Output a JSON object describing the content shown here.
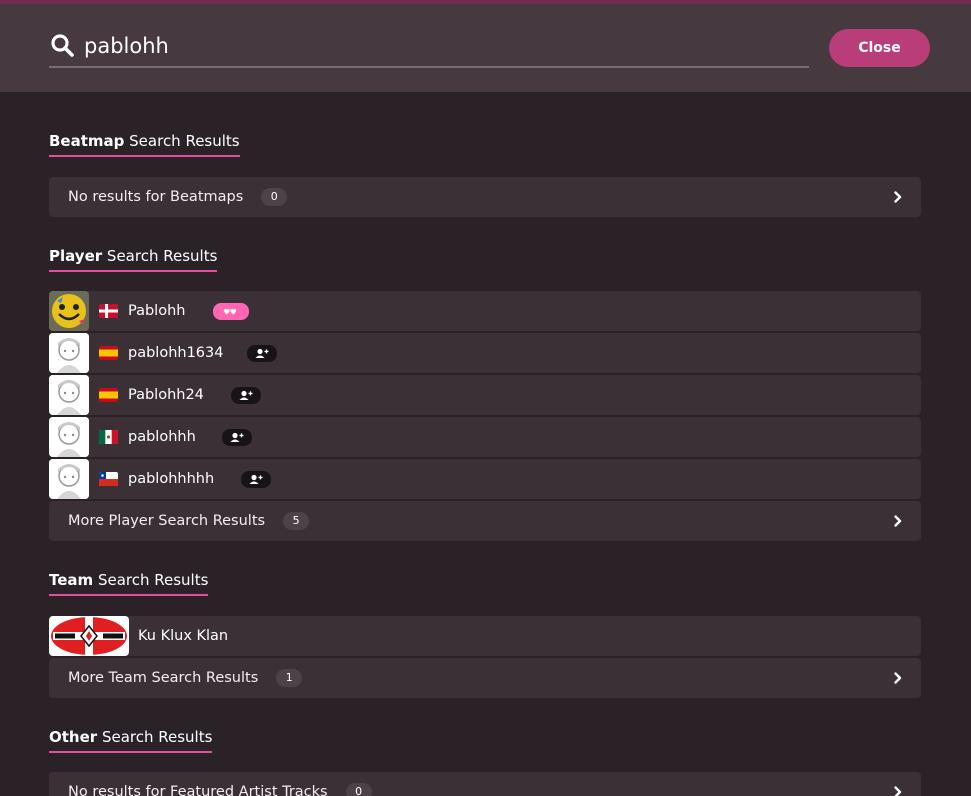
{
  "search": {
    "value": "pablohh"
  },
  "header": {
    "close_label": "Close"
  },
  "sections": {
    "beatmap": {
      "title_bold": "Beatmap",
      "title_rest": " Search Results",
      "empty_label": "No results for Beatmaps",
      "count": "0"
    },
    "player": {
      "title_bold": "Player",
      "title_rest": " Search Results",
      "players": [
        {
          "name": "Pablohh",
          "flag": "Denmark"
        },
        {
          "name": "pablohh1634",
          "flag": "Spain"
        },
        {
          "name": "Pablohh24",
          "flag": "Spain"
        },
        {
          "name": "pablohhh",
          "flag": "Mexico"
        },
        {
          "name": "pablohhhhh",
          "flag": "Chile"
        }
      ],
      "more_label": "More Player Search Results",
      "more_count": "5"
    },
    "team": {
      "title_bold": "Team",
      "title_rest": " Search Results",
      "teams": [
        {
          "name": "Ku Klux Klan"
        }
      ],
      "more_label": "More Team Search Results",
      "more_count": "1"
    },
    "other": {
      "title_bold": "Other",
      "title_rest": " Search Results",
      "empty_label": "No results for Featured Artist Tracks",
      "count": "0"
    }
  },
  "colors": {
    "accent": "#b83d79",
    "underline": "#e44ea0",
    "supporter": "#ff66b3",
    "row_bg": "#3a3035",
    "page_bg": "#2a2226",
    "header_bg": "#463a40"
  },
  "icons": {
    "search": "search-icon",
    "chevron": "chevron-right-icon",
    "add_friend": "add-friend-icon",
    "supporter": "supporter-hearts-icon"
  }
}
